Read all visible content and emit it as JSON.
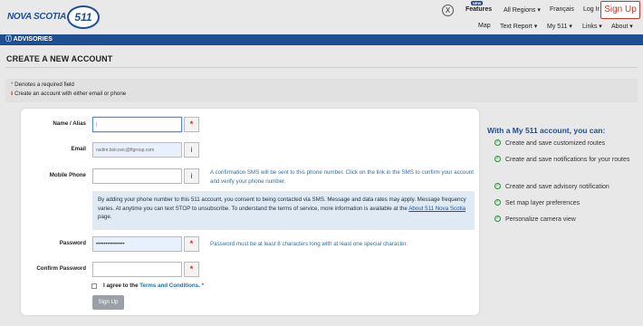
{
  "header": {
    "logo_text": "NOVA SCOTIA",
    "logo_badge": "511",
    "x_icon": "X",
    "new_badge": "NEW",
    "features_label": "Features",
    "regions_label": "All Regions ▾",
    "francais_label": "Français",
    "login_label": "Log In",
    "signup_label": "Sign Up",
    "sub_nav": [
      "Map",
      "Text Report ▾",
      "My 511 ▾",
      "Links ▾",
      "About ▾"
    ]
  },
  "advisories": {
    "label": "ⓘ ADVISORIES"
  },
  "page": {
    "title": "CREATE A NEW ACCOUNT"
  },
  "notice": {
    "req_star": "*",
    "required_text": "Denotes a required field",
    "info_icon": "ℹ",
    "either_text": "Create an account with either email or phone"
  },
  "form": {
    "name_label": "Name / Alias",
    "name_value": "|",
    "email_label": "Email",
    "email_value": "nsdim.bolcovic@ftgroup.com",
    "mobile_label": "Mobile Phone",
    "mobile_value": "",
    "mobile_help": "A confirmation SMS will be sent to this phone number. Click on the link in the SMS to confirm your account and verify your phone number.",
    "consent_text": "By adding your phone number to this 511 account, you consent to being contacted via SMS. Message and data rates may apply. Message frequency varies. At anytime you can text STOP to unsubscribe. To understand the terms of service, more information is available at the ",
    "consent_link": "About 511 Nova Scotia",
    "consent_tail": " page.",
    "password_label": "Password",
    "password_value": "•••••••••••••••",
    "password_help": "Password must be at least 8 characters long with at least one special character.",
    "confirm_label": "Confirm Password",
    "confirm_value": "",
    "agree_prefix": "I agree to the ",
    "agree_link": "Terms and Conditions",
    "agree_suffix": ".",
    "req_star": "*",
    "info_glyph": "i",
    "submit_label": "Sign Up"
  },
  "benefits": {
    "title": "With a My 511 account, you can:",
    "items": [
      "Create and save customized routes",
      "Create and save notifications for your routes",
      "Create and save advisory notification",
      "Set map layer preferences",
      "Personalize camera view"
    ]
  }
}
